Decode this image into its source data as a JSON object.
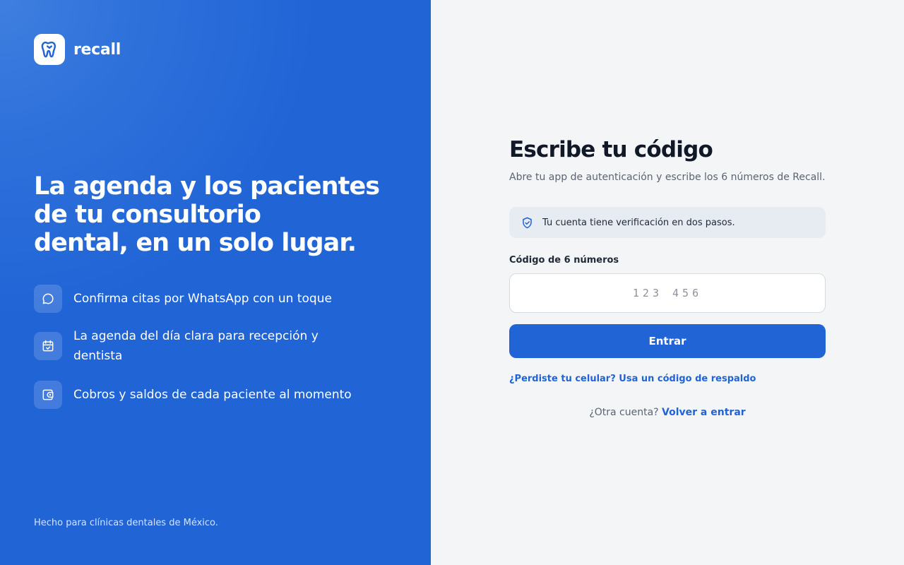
{
  "brand": {
    "name": "recall",
    "logo_icon": "tooth-icon"
  },
  "hero": {
    "headline_lines": [
      "La agenda y los pacientes",
      "de tu consultorio",
      "dental, en un solo lugar."
    ]
  },
  "features": [
    {
      "icon": "chat-bubble-icon",
      "text": "Confirma citas por WhatsApp con un toque"
    },
    {
      "icon": "calendar-check-icon",
      "text": "La agenda del día clara para recepción y dentista"
    },
    {
      "icon": "wallet-icon",
      "text": "Cobros y saldos de cada paciente al momento"
    }
  ],
  "footer_note": "Hecho para clínicas dentales de México.",
  "form": {
    "title": "Escribe tu código",
    "subtitle": "Abre tu app de autenticación y escribe los 6 números de Recall.",
    "notice": {
      "icon": "shield-check-icon",
      "text": "Tu cuenta tiene verificación en dos pasos."
    },
    "code_label": "Código de 6 números",
    "code_value": "",
    "code_placeholder": "123 456",
    "submit_label": "Entrar",
    "backup_link": "¿Perdiste tu celular? Usa un código de respaldo",
    "other_account_prompt": "¿Otra cuenta?",
    "other_account_link": "Volver a entrar"
  },
  "colors": {
    "brand_blue": "#2064d6",
    "page_bg": "#f3f5f7",
    "heading_text": "#111827",
    "muted_text": "#5b6473"
  }
}
